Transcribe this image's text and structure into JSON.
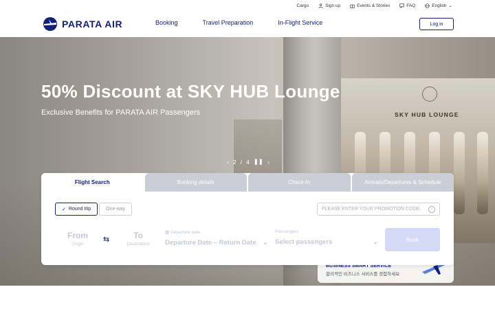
{
  "topbar": {
    "cargo": "Cargo",
    "signup": "Sign up",
    "events": "Events & Stories",
    "faq": "FAQ",
    "language": "English"
  },
  "brand": {
    "name": "PARATA AIR"
  },
  "nav": {
    "booking": "Booking",
    "travel_preparation": "Travel Preparation",
    "inflight": "In-Flight Service",
    "login": "Log in"
  },
  "hero": {
    "title": "50% Discount at SKY HUB Lounge",
    "subtitle": "Exclusive Benefits for PARATA AIR Passengers",
    "lounge_sign": "SKY HUB LOUNGE",
    "pager_current": "2",
    "pager_sep": "/",
    "pager_total": "4"
  },
  "search": {
    "tabs": [
      "Flight Search",
      "Booking details",
      "Check-In",
      "Arrivals/Departures & Schedule"
    ],
    "round_trip": "Round trip",
    "one_way": "One-way",
    "promo_placeholder": "PLEASE ENTER YOUR PROMOTION CODE.",
    "from": "From",
    "origin": "Origin",
    "to": "To",
    "destination": "Destination",
    "departure_label": "Departure date",
    "departure_value": "Departure Date – Return Date",
    "passengers_label": "Passengers",
    "passengers_value": "Select passengers",
    "book": "Book"
  },
  "promo_banner": {
    "title": "BUSINESS SMART SERVICE",
    "text": "합리적인 비즈니스 서비스를 경험하세요"
  },
  "colors": {
    "brand": "#13207a",
    "book_button": "#d4d9f6"
  }
}
